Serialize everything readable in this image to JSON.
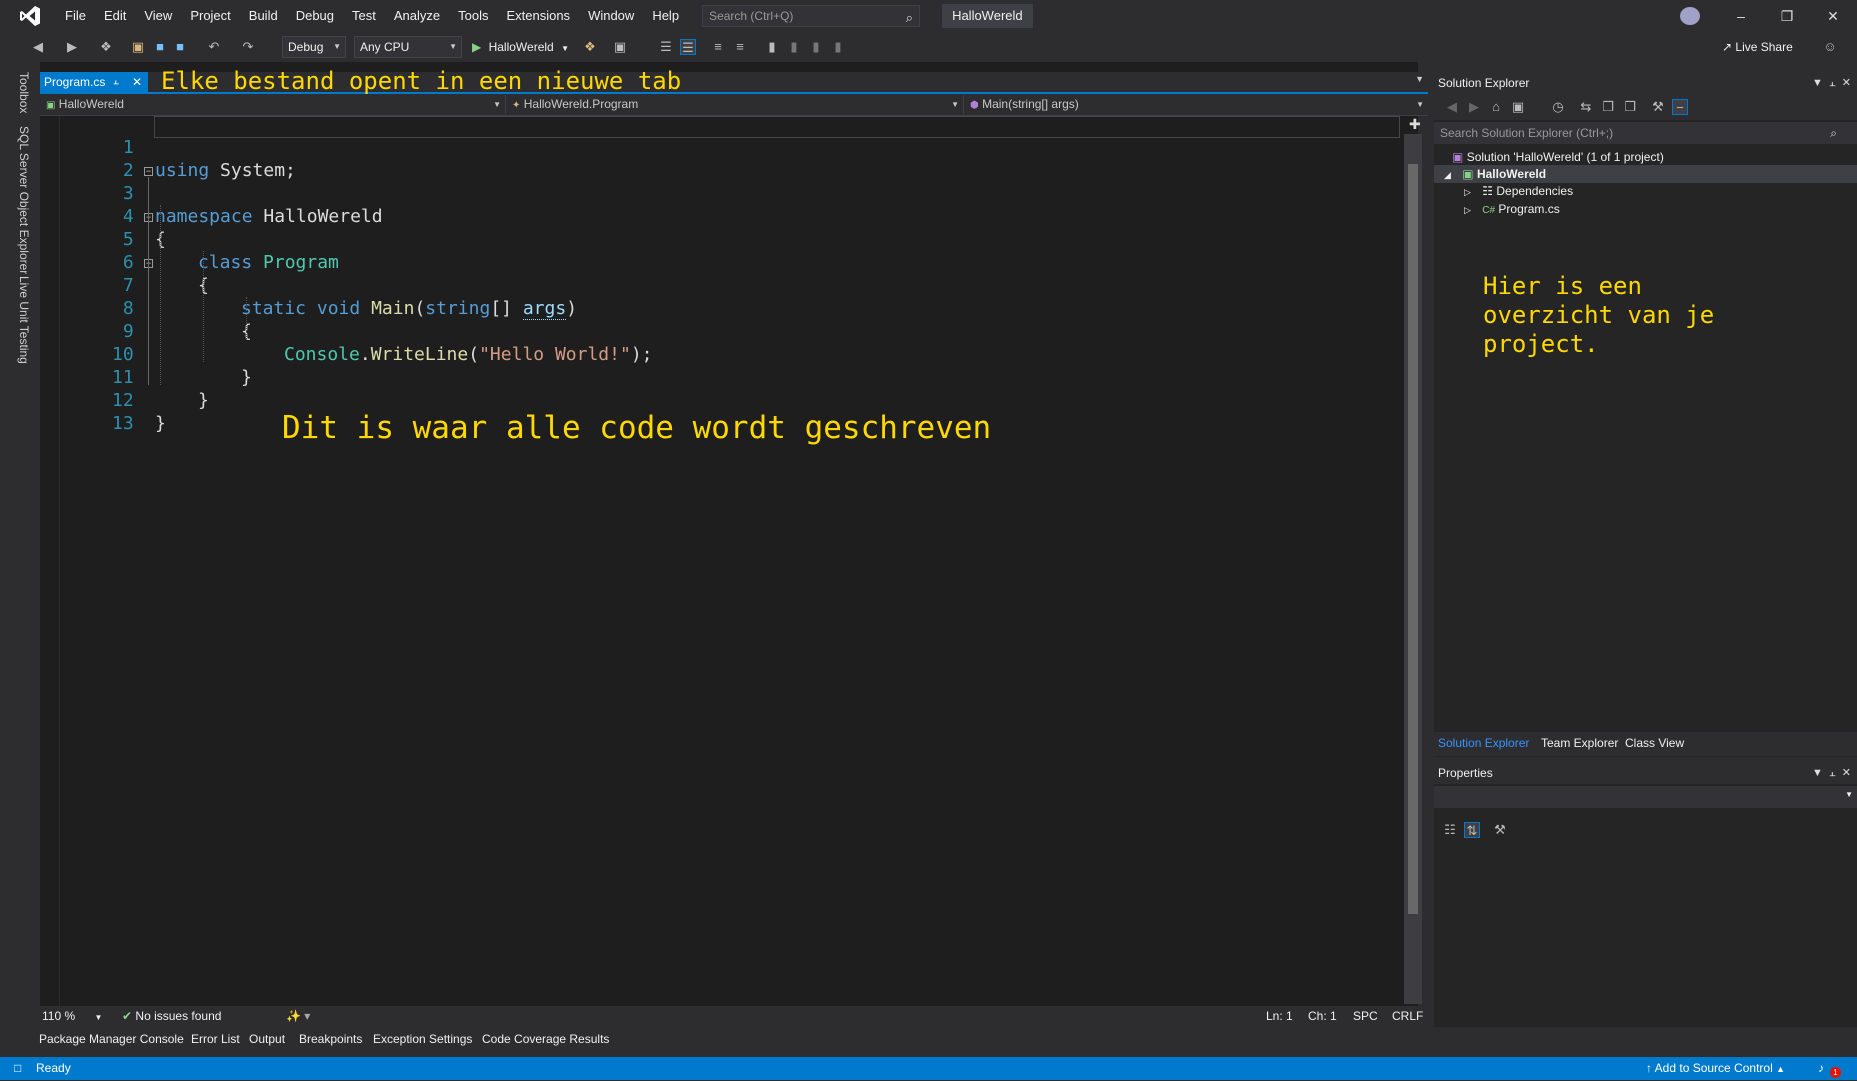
{
  "menu": [
    "File",
    "Edit",
    "View",
    "Project",
    "Build",
    "Debug",
    "Test",
    "Analyze",
    "Tools",
    "Extensions",
    "Window",
    "Help"
  ],
  "search_placeholder": "Search (Ctrl+Q)",
  "solution_name": "HalloWereld",
  "toolbar": {
    "config": "Debug",
    "platform": "Any CPU",
    "run_target": "HalloWereld",
    "live_share": "Live Share"
  },
  "left_tabs": [
    "Toolbox",
    "SQL Server Object Explorer",
    "Live Unit Testing"
  ],
  "doc_tab": "Program.cs",
  "annotations": {
    "tabs": "Elke bestand opent in een nieuwe tab",
    "code": "Dit is waar alle code wordt geschreven",
    "solution": "Hier is een\noverzicht van je\nproject."
  },
  "navbar": {
    "project": "HalloWereld",
    "type": "HalloWereld.Program",
    "member": "Main(string[] args)"
  },
  "code": {
    "line_numbers": [
      "1",
      "2",
      "3",
      "4",
      "5",
      "6",
      "7",
      "8",
      "9",
      "10",
      "11",
      "12",
      "13"
    ],
    "l1_kw": "using",
    "l1_rest": " System;",
    "l3_kw": "namespace",
    "l3_rest": " HalloWereld",
    "brace_open": "{",
    "brace_close": "}",
    "l5_kw": "class",
    "l5_type": "Program",
    "l7_kw1": "static",
    "l7_kw2": "void",
    "l7_mth": "Main",
    "l7_p1": "(",
    "l7_kw3": "string",
    "l7_p2": "[] ",
    "l7_arg": "args",
    "l7_p3": ")",
    "l9_type": "Console",
    "l9_dot": ".",
    "l9_mth": "WriteLine",
    "l9_p1": "(",
    "l9_str": "\"Hello World!\"",
    "l9_p2": ");"
  },
  "editor_status": {
    "zoom": "110 %",
    "issues": "No issues found",
    "ln": "Ln: 1",
    "ch": "Ch: 1",
    "spc": "SPC",
    "crlf": "CRLF"
  },
  "bottom_tabs": [
    "Package Manager Console",
    "Error List",
    "Output",
    "Breakpoints",
    "Exception Settings",
    "Code Coverage Results"
  ],
  "statusbar": {
    "ready": "Ready",
    "source_control": "Add to Source Control",
    "notifications": "1"
  },
  "solution_explorer": {
    "title": "Solution Explorer",
    "search_placeholder": "Search Solution Explorer (Ctrl+;)",
    "solution_label": "Solution 'HalloWereld' (1 of 1 project)",
    "project": "HalloWereld",
    "dependencies": "Dependencies",
    "file": "Program.cs",
    "tabs": [
      "Solution Explorer",
      "Team Explorer",
      "Class View"
    ]
  },
  "properties_title": "Properties",
  "colors": {
    "accent": "#007acc",
    "annotation": "#ffd800",
    "keyword": "#569cd6",
    "type": "#4ec9b0",
    "string": "#d69d85"
  }
}
